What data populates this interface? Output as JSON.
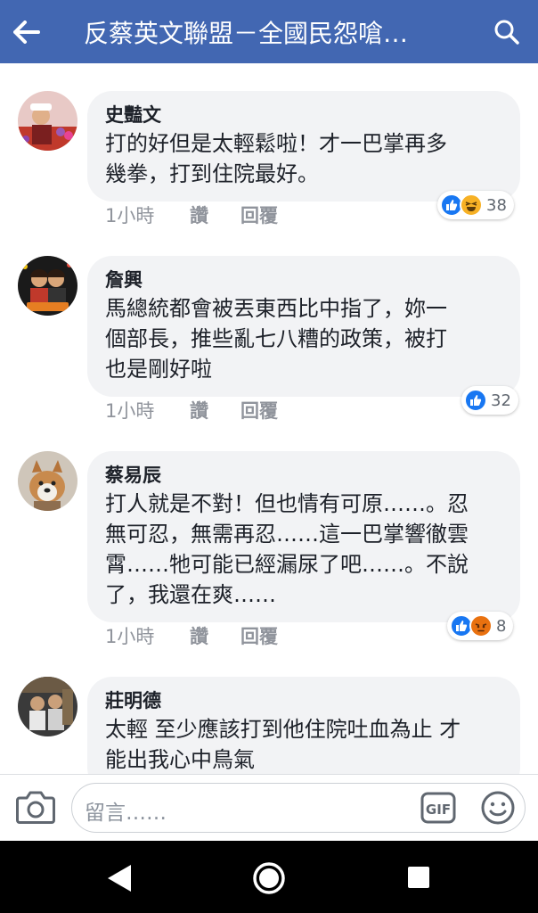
{
  "header": {
    "title": "反蔡英文聯盟－全國民怨嗆…"
  },
  "comments": [
    {
      "author": "史豔文",
      "lines": [
        "打的好但是太輕鬆啦！才一巴掌再多",
        "幾拳，打到住院最好。"
      ],
      "time": "1小時",
      "like_label": "讚",
      "reply_label": "回覆",
      "reactions": [
        "like",
        "haha"
      ],
      "reaction_count": "38"
    },
    {
      "author": "詹興",
      "lines": [
        "馬總統都會被丟東西比中指了，妳一",
        "個部長，推些亂七八糟的政策，被打",
        "也是剛好啦"
      ],
      "time": "1小時",
      "like_label": "讚",
      "reply_label": "回覆",
      "reactions": [
        "like"
      ],
      "reaction_count": "32"
    },
    {
      "author": "蔡易辰",
      "lines": [
        "打人就是不對！但也情有可原……。忍",
        "無可忍，無需再忍……這一巴掌響徹雲",
        "霄……牠可能已經漏尿了吧……。不說",
        "了，我還在爽……"
      ],
      "time": "1小時",
      "like_label": "讚",
      "reply_label": "回覆",
      "reactions": [
        "like",
        "angry"
      ],
      "reaction_count": "8"
    },
    {
      "author": "莊明德",
      "lines": [
        "太輕 至少應該打到他住院吐血為止 才",
        "能出我心中鳥氣"
      ]
    }
  ],
  "composer": {
    "placeholder": "留言……"
  },
  "colors": {
    "brand": "#4267b2",
    "like": "#1877f2",
    "haha": "#f7b125",
    "angry": "#e9710f"
  }
}
